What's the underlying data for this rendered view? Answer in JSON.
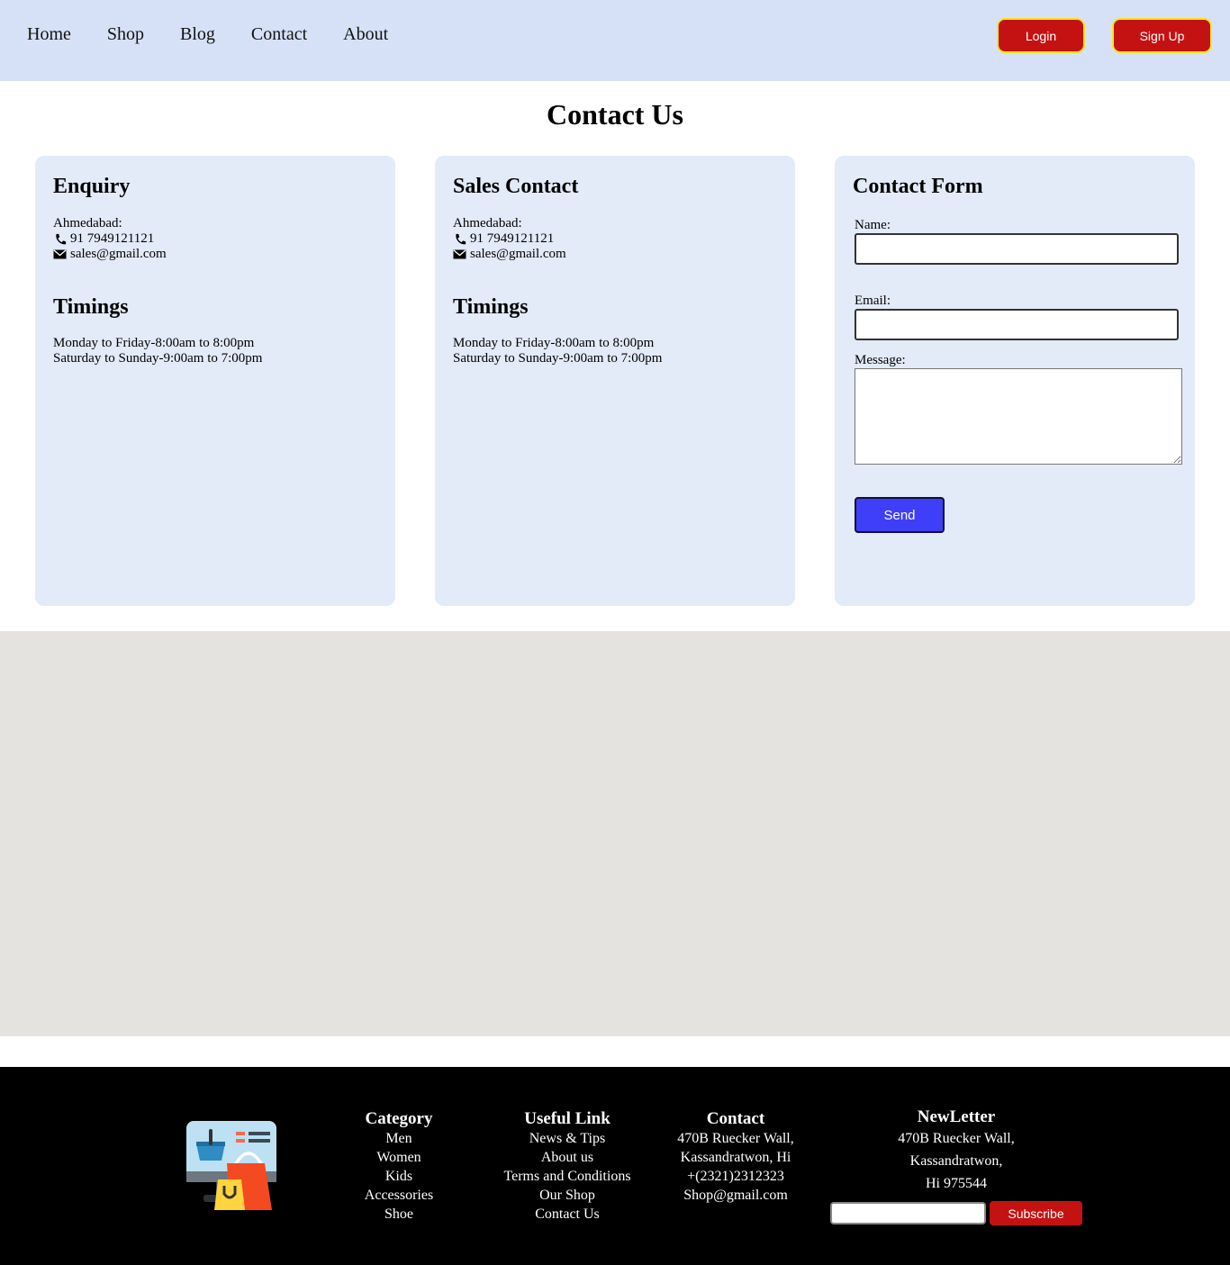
{
  "nav": {
    "links": [
      "Home",
      "Shop",
      "Blog",
      "Contact",
      "About"
    ],
    "login_label": "Login",
    "signup_label": "Sign Up"
  },
  "page_title": "Contact Us",
  "cards": [
    {
      "title": "Enquiry",
      "city": "Ahmedabad:",
      "phone": "91 7949121121",
      "email": "sales@gmail.com",
      "timings_title": "Timings",
      "weekday": "Monday to Friday-8:00am to 8:00pm",
      "weekend": "Saturday to Sunday-9:00am to 7:00pm"
    },
    {
      "title": "Sales Contact",
      "city": "Ahmedabad:",
      "phone": "91 7949121121",
      "email": "sales@gmail.com",
      "timings_title": "Timings",
      "weekday": "Monday to Friday-8:00am to 8:00pm",
      "weekend": "Saturday to Sunday-9:00am to 7:00pm"
    }
  ],
  "form": {
    "title": "Contact Form",
    "name_label": "Name:",
    "email_label": "Email:",
    "message_label": "Message:",
    "send_label": "Send"
  },
  "footer": {
    "category": {
      "title": "Category",
      "items": [
        "Men",
        "Women",
        "Kids",
        "Accessories",
        "Shoe"
      ]
    },
    "useful": {
      "title": "Useful Link",
      "items": [
        "News & Tips",
        "About us",
        "Terms and Conditions",
        "Our Shop",
        "Contact Us"
      ]
    },
    "contact": {
      "title": "Contact",
      "items": [
        "470B Ruecker Wall,",
        "Kassandratwon, Hi",
        "+(2321)2312323",
        "Shop@gmail.com"
      ]
    },
    "newsletter": {
      "title": "NewLetter",
      "lines": [
        "470B Ruecker Wall,",
        "Kassandratwon,",
        "Hi 975544"
      ],
      "subscribe_label": "Subscribe"
    }
  },
  "colors": {
    "nav_bg": "#d6e1f8",
    "card_bg": "#e3eaf8",
    "button_red": "#c41212",
    "button_blue": "#3f3ef9",
    "map_bg": "#e4e3df",
    "footer_bg": "#000000"
  }
}
